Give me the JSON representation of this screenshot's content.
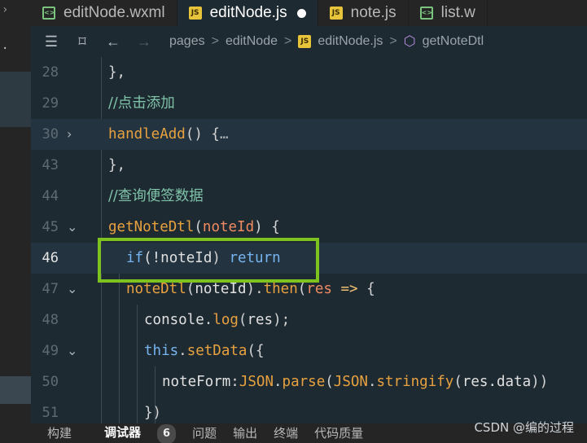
{
  "tabs": [
    {
      "label": "editNode.wxml",
      "icon": "wxml-file-icon",
      "active": false
    },
    {
      "label": "editNode.js",
      "icon": "js-file-icon",
      "active": true,
      "dirty": true
    },
    {
      "label": "note.js",
      "icon": "js-file-icon",
      "active": false
    },
    {
      "label": "list.w",
      "icon": "wxml-file-icon",
      "active": false
    }
  ],
  "breadcrumb": {
    "folder": "pages",
    "subfolder": "editNode",
    "file": "editNode.js",
    "symbol": "getNoteDtl",
    "separator": ">"
  },
  "lines": [
    {
      "num": "28",
      "text": "},"
    },
    {
      "num": "29",
      "text": "//点击添加"
    },
    {
      "num": "30",
      "fn": "handleAdd",
      "rest": "() {",
      "ellipsis": "…"
    },
    {
      "num": "43",
      "text": "},"
    },
    {
      "num": "44",
      "text": "//查询便签数据"
    },
    {
      "num": "45",
      "fn": "getNoteDtl",
      "param": "noteId",
      "rest": ") {"
    },
    {
      "num": "46",
      "kw": "if",
      "op": "(!",
      "id": "noteId",
      "rest": ") ",
      "ret": "return"
    },
    {
      "num": "47",
      "fn": "noteDtl",
      "id": "noteId",
      "method": "then",
      "param": "res",
      "arrow": "=>",
      "rest": " {"
    },
    {
      "num": "48",
      "obj": "console",
      "method": "log",
      "id": "res",
      "rest": ");"
    },
    {
      "num": "49",
      "kw": "this",
      "method": "setData",
      "rest": "({"
    },
    {
      "num": "50",
      "prop": "noteForm",
      "json1": "JSON",
      "m1": "parse",
      "json2": "JSON",
      "m2": "stringify",
      "arg": "res.data",
      "rest": "))"
    },
    {
      "num": "51",
      "text": "})"
    }
  ],
  "bottom_tabs": [
    {
      "label": "构建"
    },
    {
      "label": "调试器",
      "badge": "6",
      "active": true
    },
    {
      "label": "问题"
    },
    {
      "label": "输出"
    },
    {
      "label": "终端"
    },
    {
      "label": "代码质量"
    }
  ],
  "watermark": "CSDN @编的过程",
  "colors": {
    "highlight_box": "#7dc21e",
    "editor_bg": "#1e2a32",
    "keyword": "#76b4f0",
    "function": "#e8a13f",
    "comment": "#7fc3a8"
  }
}
